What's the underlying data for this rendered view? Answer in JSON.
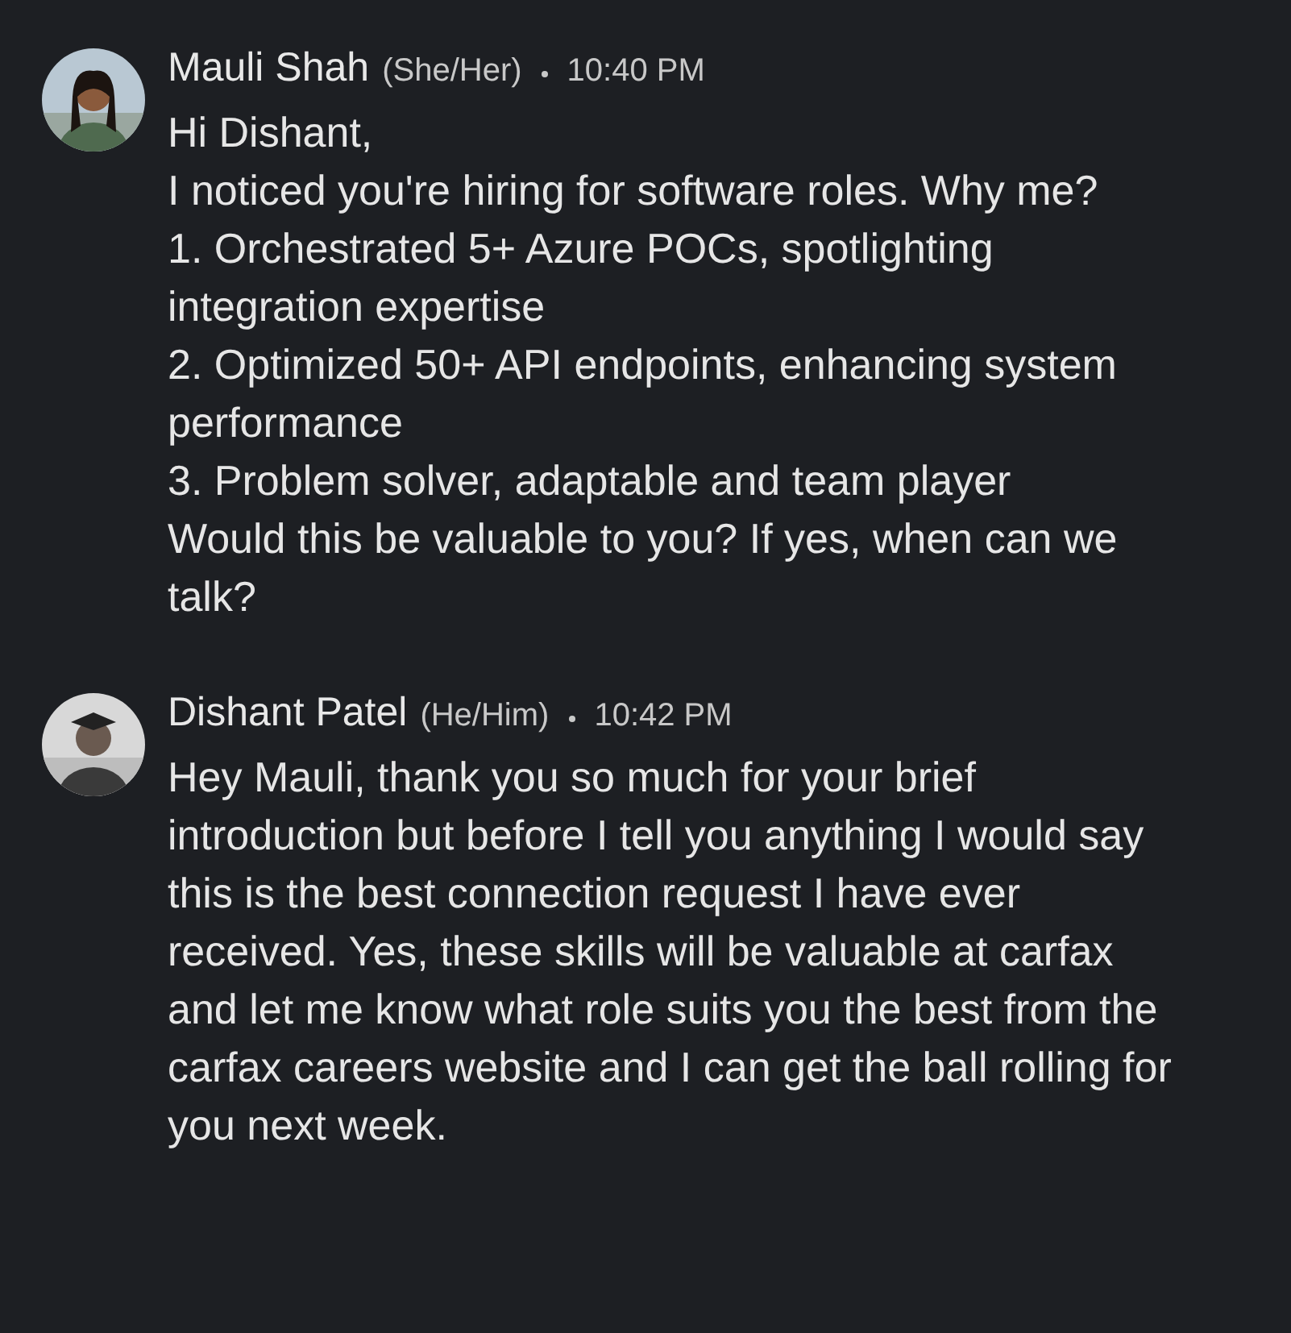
{
  "messages": [
    {
      "sender": "Mauli Shah",
      "pronouns": "(She/Her)",
      "time": "10:40 PM",
      "avatar": {
        "kind": "picture"
      },
      "lines": [
        "Hi Dishant,",
        "I noticed you're hiring for software roles. Why me?",
        "1. Orchestrated 5+ Azure POCs, spotlighting integration expertise",
        "2. Optimized 50+ API endpoints, enhancing system performance",
        "3. Problem solver, adaptable and team player",
        "Would this be valuable to you? If yes, when can we talk?"
      ]
    },
    {
      "sender": "Dishant Patel",
      "pronouns": "(He/Him)",
      "time": "10:42 PM",
      "avatar": {
        "kind": "picture"
      },
      "lines": [
        "Hey Mauli, thank you so much for your brief introduction but before I tell you anything I would say this is the best connection request I have ever received. Yes, these skills will be valuable at carfax and let me know what role suits you the best from the carfax careers website and I can get the ball rolling for you next week."
      ]
    }
  ]
}
